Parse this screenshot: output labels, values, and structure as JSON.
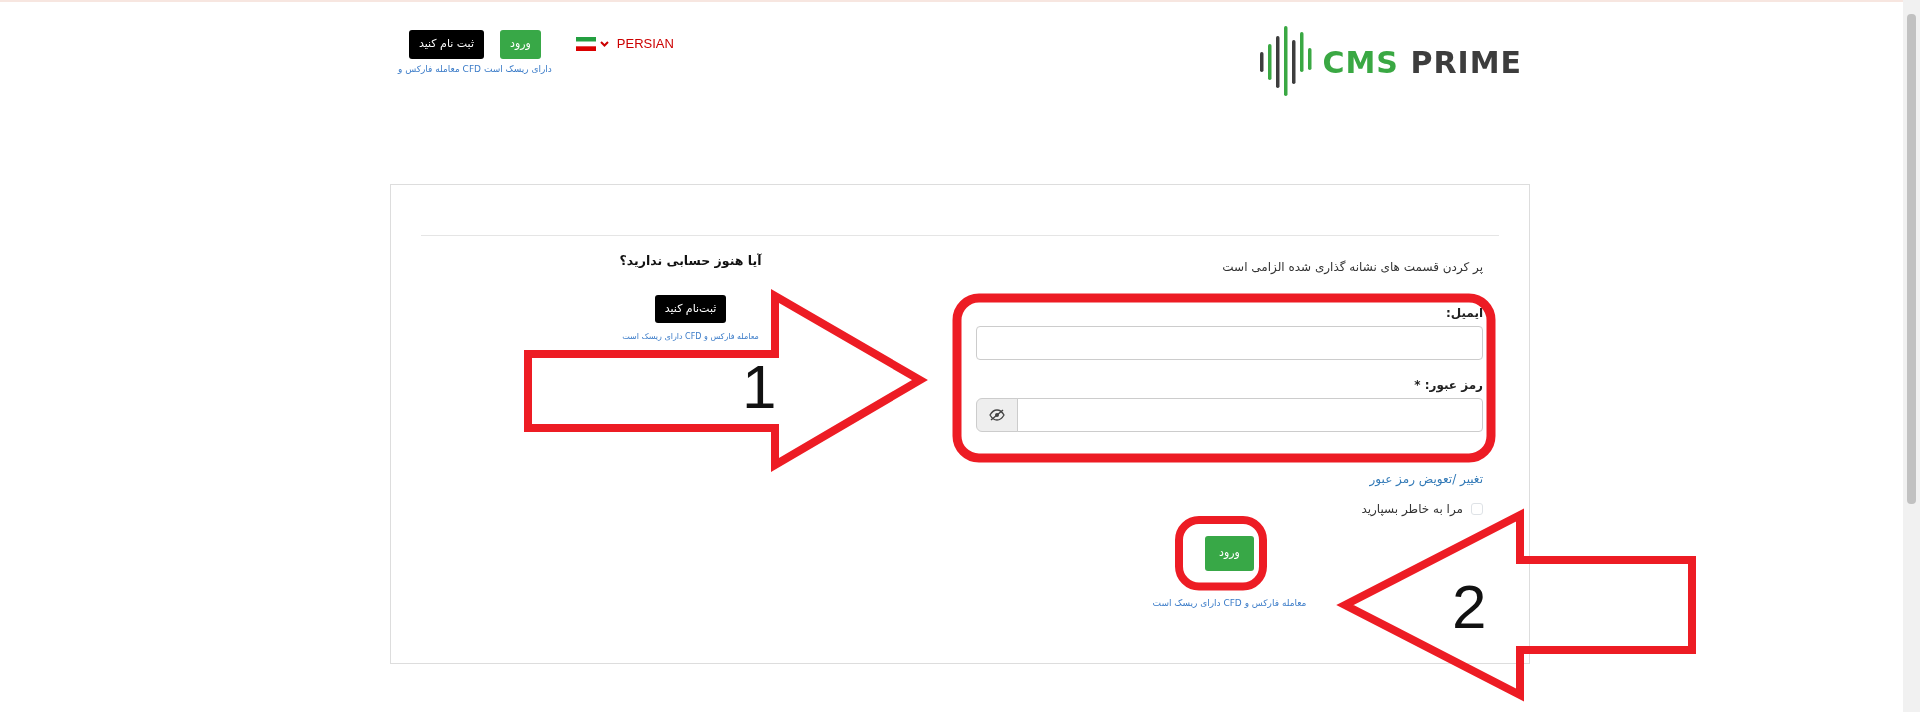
{
  "header": {
    "logo": {
      "brand": "CMS",
      "suffix": "PRIME"
    },
    "language": {
      "label": "PERSIAN"
    },
    "buttons": [
      {
        "label": "ورود",
        "kind": "success"
      },
      {
        "label": "ثبت نام کنید",
        "kind": "dark"
      }
    ],
    "risk_note": "معامله فارکس و CFD دارای ریسک است"
  },
  "login_form": {
    "required_note": "پر کردن قسمت های نشانه گذاری شده الزامی است",
    "fields": [
      {
        "label": "ایمیل:",
        "kind": "text"
      },
      {
        "label": "رمز عبور: *",
        "kind": "password"
      }
    ],
    "reset_link": "تغییر /تعویض رمز عبور",
    "remember": {
      "label": "مرا به خاطر بسپارید",
      "checked": false
    },
    "submit": "ورود",
    "risk_note": "معامله فارکس و CFD دارای ریسک است"
  },
  "signup": {
    "title": "آیا هنوز حسابی ندارید؟",
    "button": "ثبت‌نام کنید",
    "risk_note": "معامله فارکس و CFD دارای ریسک است"
  },
  "annotations": [
    {
      "number": "1"
    },
    {
      "number": "2"
    }
  ]
}
